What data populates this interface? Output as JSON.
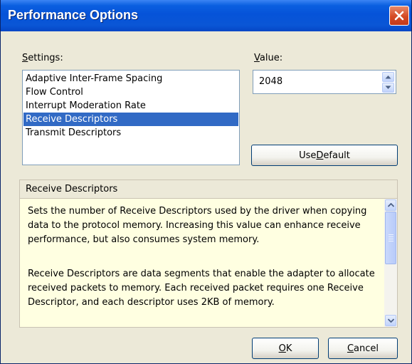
{
  "window": {
    "title": "Performance Options",
    "close_icon": "close-icon"
  },
  "settings": {
    "label": "Settings:",
    "items": [
      {
        "label": "Adaptive Inter-Frame Spacing",
        "selected": false
      },
      {
        "label": "Flow Control",
        "selected": false
      },
      {
        "label": "Interrupt Moderation Rate",
        "selected": false
      },
      {
        "label": "Receive Descriptors",
        "selected": true
      },
      {
        "label": "Transmit Descriptors",
        "selected": false
      }
    ]
  },
  "value": {
    "label": "Value:",
    "current": "2048",
    "spin_up_icon": "spin-up-icon",
    "spin_down_icon": "spin-down-icon"
  },
  "buttons": {
    "use_default": "Use Default",
    "ok": "OK",
    "cancel": "Cancel"
  },
  "description": {
    "title": "Receive Descriptors",
    "paragraphs": [
      "Sets the number of Receive Descriptors used by the driver when copying data to the protocol memory. Increasing this value can enhance receive performance, but also consumes system memory.",
      "Receive Descriptors are data segments that enable the adapter to allocate received packets to memory. Each received packet requires one Receive Descriptor, and each descriptor uses 2KB of memory."
    ]
  },
  "colors": {
    "selection": "#316ac5",
    "description_background": "#ffffe1",
    "titlebar": "#0653d8"
  }
}
